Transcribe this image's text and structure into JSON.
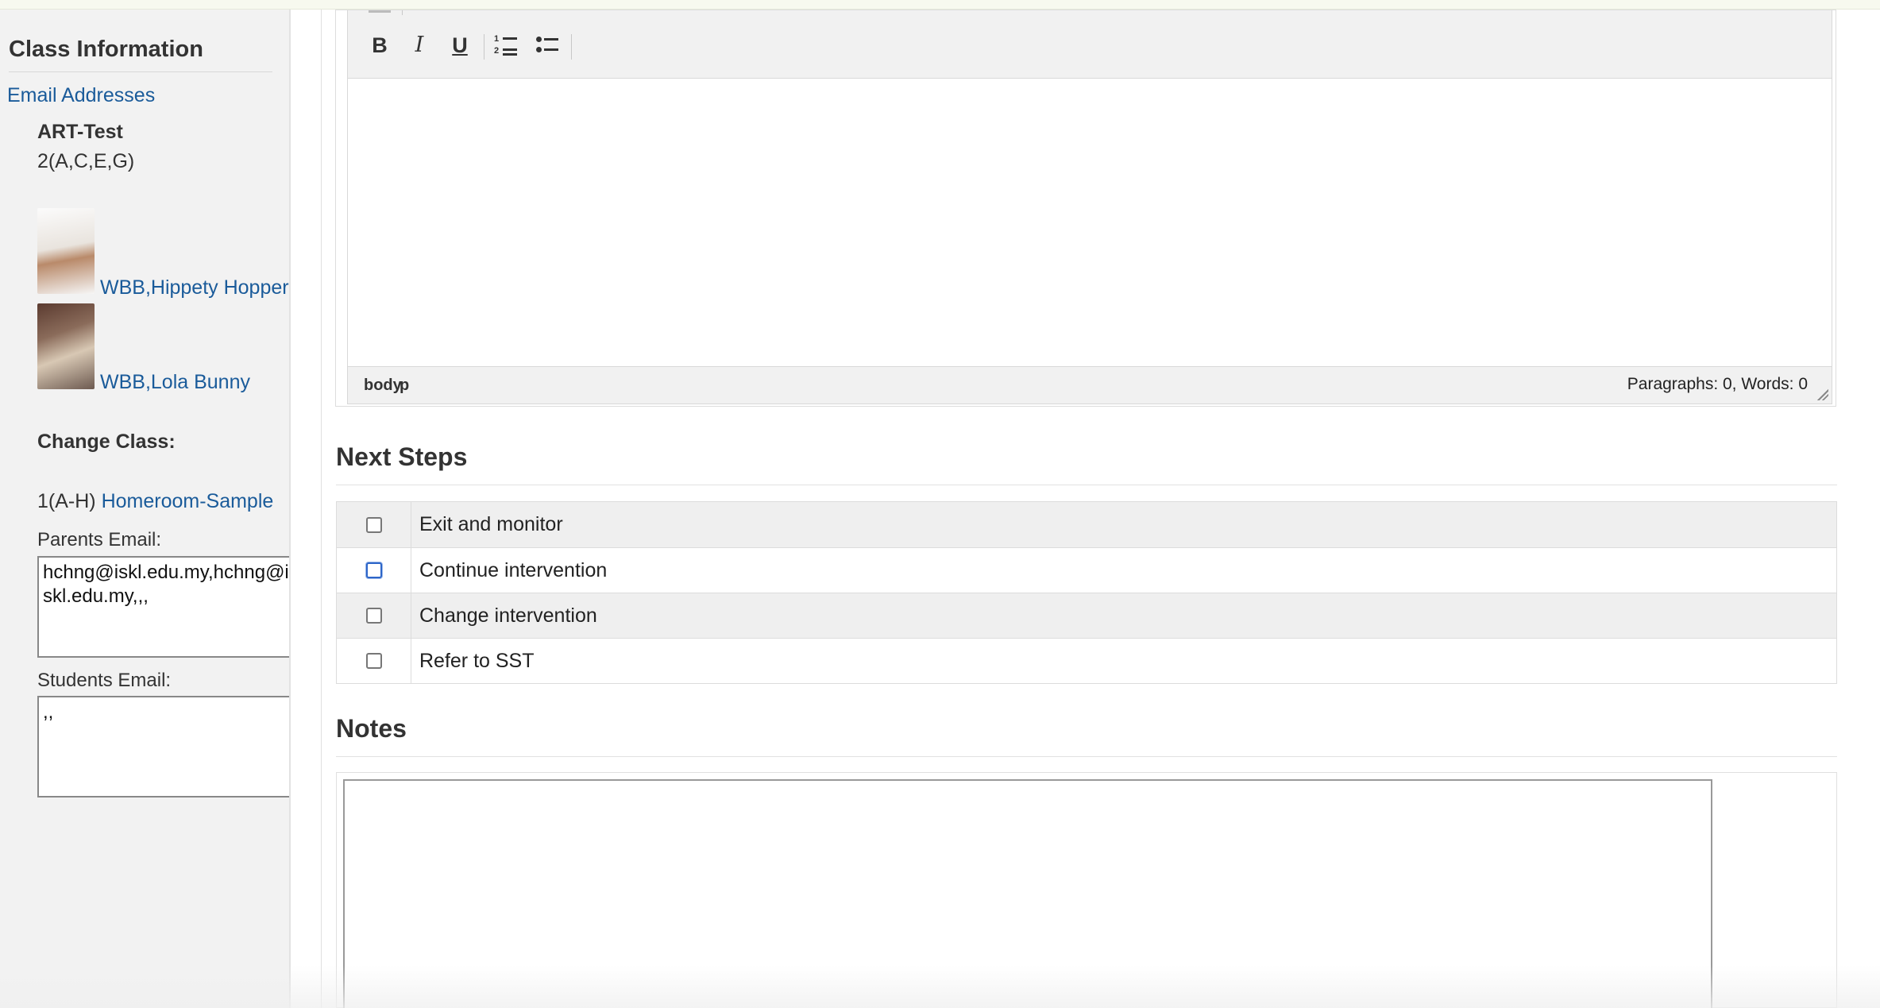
{
  "sidebar": {
    "title": "Class Information",
    "email_link": "Email Addresses",
    "class_code": "ART-Test",
    "class_period": "2(A,C,E,G)",
    "students": [
      {
        "name": "WBB,Hippety Hopper"
      },
      {
        "name": "WBB,Lola Bunny"
      }
    ],
    "change_class_label": "Change Class:",
    "other_class_period": "1(A-H)",
    "other_class_link": "Homeroom-Sample",
    "parents_email_label": "Parents Email:",
    "parents_email_value": "hchng@iskl.edu.my,hchng@iskl.edu.my,,,",
    "students_email_label": "Students Email:",
    "students_email_value": ",,"
  },
  "editor": {
    "toolbar": {
      "bold": "B",
      "italic": "I",
      "underline": "U"
    },
    "path": [
      "body",
      "p"
    ],
    "word_count": "Paragraphs: 0, Words: 0"
  },
  "next_steps": {
    "title": "Next Steps",
    "items": [
      {
        "label": "Exit and monitor",
        "checked": false
      },
      {
        "label": "Continue intervention",
        "checked": false
      },
      {
        "label": "Change intervention",
        "checked": false
      },
      {
        "label": "Refer to SST",
        "checked": false
      }
    ]
  },
  "notes": {
    "title": "Notes",
    "value": ""
  },
  "colors": {
    "link": "#1a5b9a",
    "sidebar_bg": "#f2f2f2",
    "row_shade": "#efefef"
  }
}
